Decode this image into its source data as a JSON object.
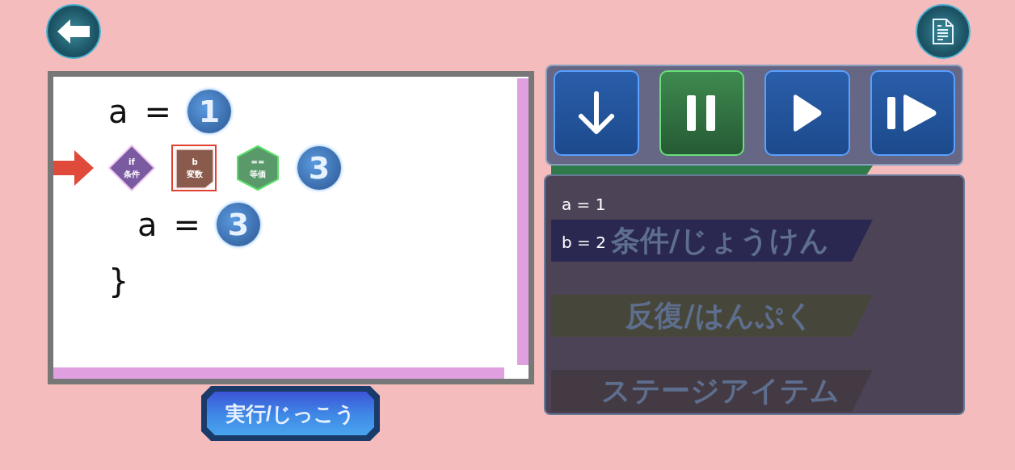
{
  "editor": {
    "lines": [
      {
        "current": false,
        "tokens": [
          {
            "kind": "word",
            "text": "a"
          },
          {
            "kind": "word",
            "text": "="
          },
          {
            "kind": "number",
            "text": "1"
          }
        ]
      },
      {
        "current": true,
        "tokens": [
          {
            "kind": "condition",
            "label": "if",
            "caption": "条件",
            "color": "#7a5aa0"
          },
          {
            "kind": "variable",
            "label": "b",
            "caption": "変数",
            "color": "#8a5a4c"
          },
          {
            "kind": "operator",
            "label": "==",
            "caption": "等価",
            "color": "#5a9a6a"
          },
          {
            "kind": "number",
            "text": "3"
          }
        ],
        "children": [
          {
            "current": false,
            "tokens": [
              {
                "kind": "word",
                "text": "a"
              },
              {
                "kind": "word",
                "text": "="
              },
              {
                "kind": "number",
                "text": "3"
              }
            ]
          }
        ]
      },
      {
        "current": false,
        "tokens": [
          {
            "kind": "word",
            "text": "}"
          }
        ]
      }
    ]
  },
  "run_button": {
    "label": "実行/じっこう"
  },
  "controls": [
    {
      "kind": "step-down",
      "selected": false
    },
    {
      "kind": "pause",
      "selected": true
    },
    {
      "kind": "play",
      "selected": false
    },
    {
      "kind": "step",
      "selected": false
    }
  ],
  "variables": [
    "a = 1",
    "b = 2"
  ],
  "covered_tab": {
    "color": "#2f7a4a"
  },
  "categories": [
    {
      "label": "条件/じょうけん",
      "color": "#2a2850"
    },
    {
      "label": "反復/はんぷく",
      "color": "#47463a"
    },
    {
      "label": "ステージアイテム",
      "color": "#443a44"
    }
  ]
}
